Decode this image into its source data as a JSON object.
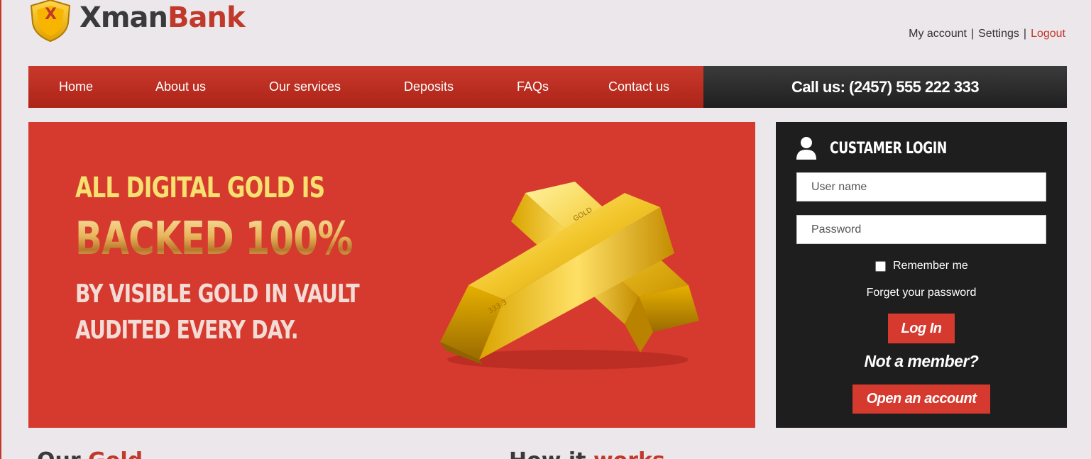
{
  "brand": {
    "name_part1": "Xman",
    "name_part2": "Bank",
    "shield_letter": "X"
  },
  "topnav": {
    "my_account": "My account",
    "settings": "Settings",
    "logout": "Logout",
    "separator": "|"
  },
  "mainnav": {
    "items": [
      {
        "label": "Home"
      },
      {
        "label": "About us"
      },
      {
        "label": "Our services"
      },
      {
        "label": "Deposits"
      },
      {
        "label": "FAQs"
      },
      {
        "label": "Contact us"
      }
    ],
    "call_us": "Call us: (2457) 555 222 333"
  },
  "hero": {
    "line1": "All digital gold is",
    "line2": "Backed 100%",
    "line3": "By visible gold in vault",
    "line4": "Audited every day."
  },
  "login": {
    "title": "CUSTAMER LOGIN",
    "username_placeholder": "User name",
    "password_placeholder": "Password",
    "remember_label": "Remember me",
    "remember_checked": false,
    "forgot_label": "Forget your password",
    "login_button": "Log In",
    "not_member": "Not a member?",
    "open_account_button": "Open an account"
  },
  "bottom": {
    "left_heading_part1": "Our ",
    "left_heading_part2": "Gold ",
    "right_heading_part1": "How it ",
    "right_heading_part2": "works"
  },
  "colors": {
    "accent": "#d63a2e",
    "dark": "#1e1e1e",
    "gold_text": "#f6e070",
    "background": "#ebe7ea"
  }
}
